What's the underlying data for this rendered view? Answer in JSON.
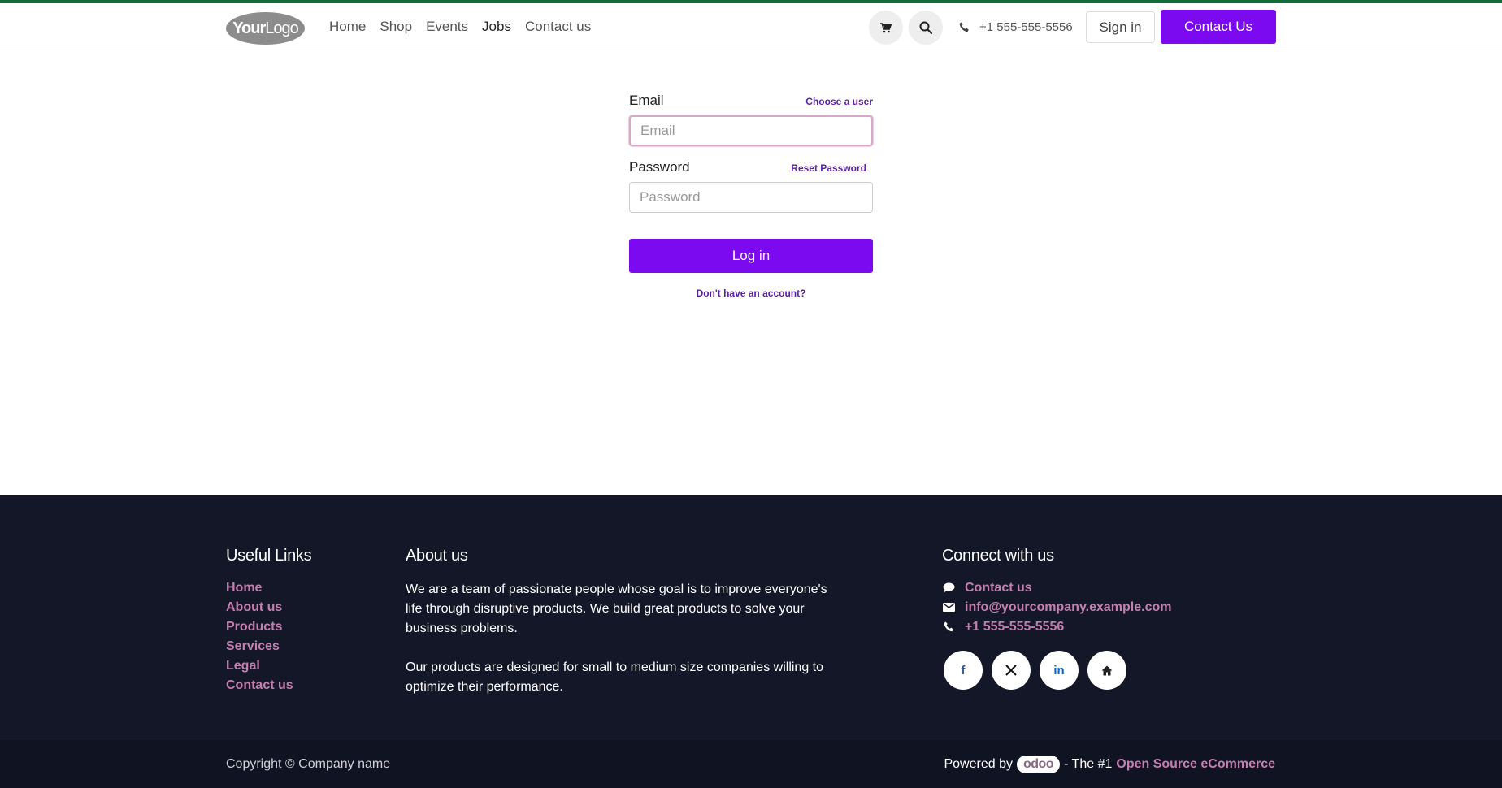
{
  "header": {
    "logo": {
      "part1": "Your",
      "part2": "Logo"
    },
    "nav": [
      {
        "label": "Home"
      },
      {
        "label": "Shop"
      },
      {
        "label": "Events"
      },
      {
        "label": "Jobs",
        "active": true
      },
      {
        "label": "Contact us"
      }
    ],
    "phone": "+1 555-555-5556",
    "sign_in": "Sign in",
    "contact_button": "Contact Us",
    "icons": [
      "cart-icon",
      "search-icon",
      "phone-icon"
    ]
  },
  "login": {
    "email_label": "Email",
    "choose_user": "Choose a user",
    "email_placeholder": "Email",
    "email_value": "",
    "password_label": "Password",
    "reset_password": "Reset Password",
    "password_placeholder": "Password",
    "password_value": "",
    "login_button": "Log in",
    "no_account": "Don't have an account?"
  },
  "footer": {
    "useful_links": {
      "title": "Useful Links",
      "items": [
        "Home",
        "About us",
        "Products",
        "Services",
        "Legal",
        "Contact us"
      ]
    },
    "about": {
      "title": "About us",
      "p1": "We are a team of passionate people whose goal is to improve everyone's life through disruptive products. We build great products to solve your business problems.",
      "p2": "Our products are designed for small to medium size companies willing to optimize their performance."
    },
    "connect": {
      "title": "Connect with us",
      "contact": "Contact us",
      "email": "info@yourcompany.example.com",
      "phone": "+1 555-555-5556",
      "socials": [
        {
          "icon": "facebook-icon",
          "glyph": "f",
          "color": "#3b5998"
        },
        {
          "icon": "x-icon",
          "glyph": "𝕏",
          "color": "#111111"
        },
        {
          "icon": "linkedin-icon",
          "glyph": "in",
          "color": "#0a66c2"
        },
        {
          "icon": "home-icon",
          "glyph": "⌂",
          "color": "#222222"
        }
      ]
    },
    "copyright": "Copyright © Company name",
    "powered_by": "Powered by",
    "odoo": "odoo",
    "tagline": "- The #1",
    "oss_link": "Open Source eCommerce"
  },
  "colors": {
    "accent": "#7c0af0",
    "link": "#c27fb0",
    "footer_bg": "#141727",
    "topline": "#0f6b3a"
  }
}
